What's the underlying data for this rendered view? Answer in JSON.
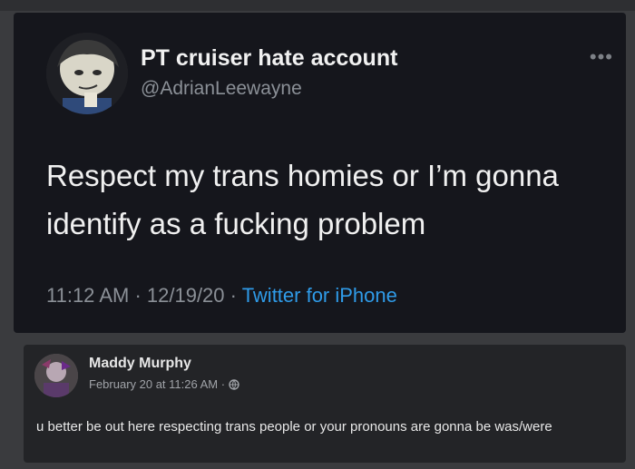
{
  "tweet": {
    "display_name": "PT cruiser hate account",
    "handle": "@AdrianLeewayne",
    "more_icon": "more-horizontal-icon",
    "text": "Respect my trans homies or I’m gonna identify as a fucking problem",
    "time": "11:12 AM",
    "sep1": " · ",
    "date": "12/19/20",
    "sep2": " · ",
    "source": "Twitter for iPhone",
    "source_color": "#2f9be8"
  },
  "comment": {
    "name": "Maddy Murphy",
    "date": "February 20 at 11:26 AM",
    "date_sep": " · ",
    "privacy_icon": "globe-icon",
    "text": "u better be out here respecting trans people or your pronouns are gonna be was/were"
  }
}
